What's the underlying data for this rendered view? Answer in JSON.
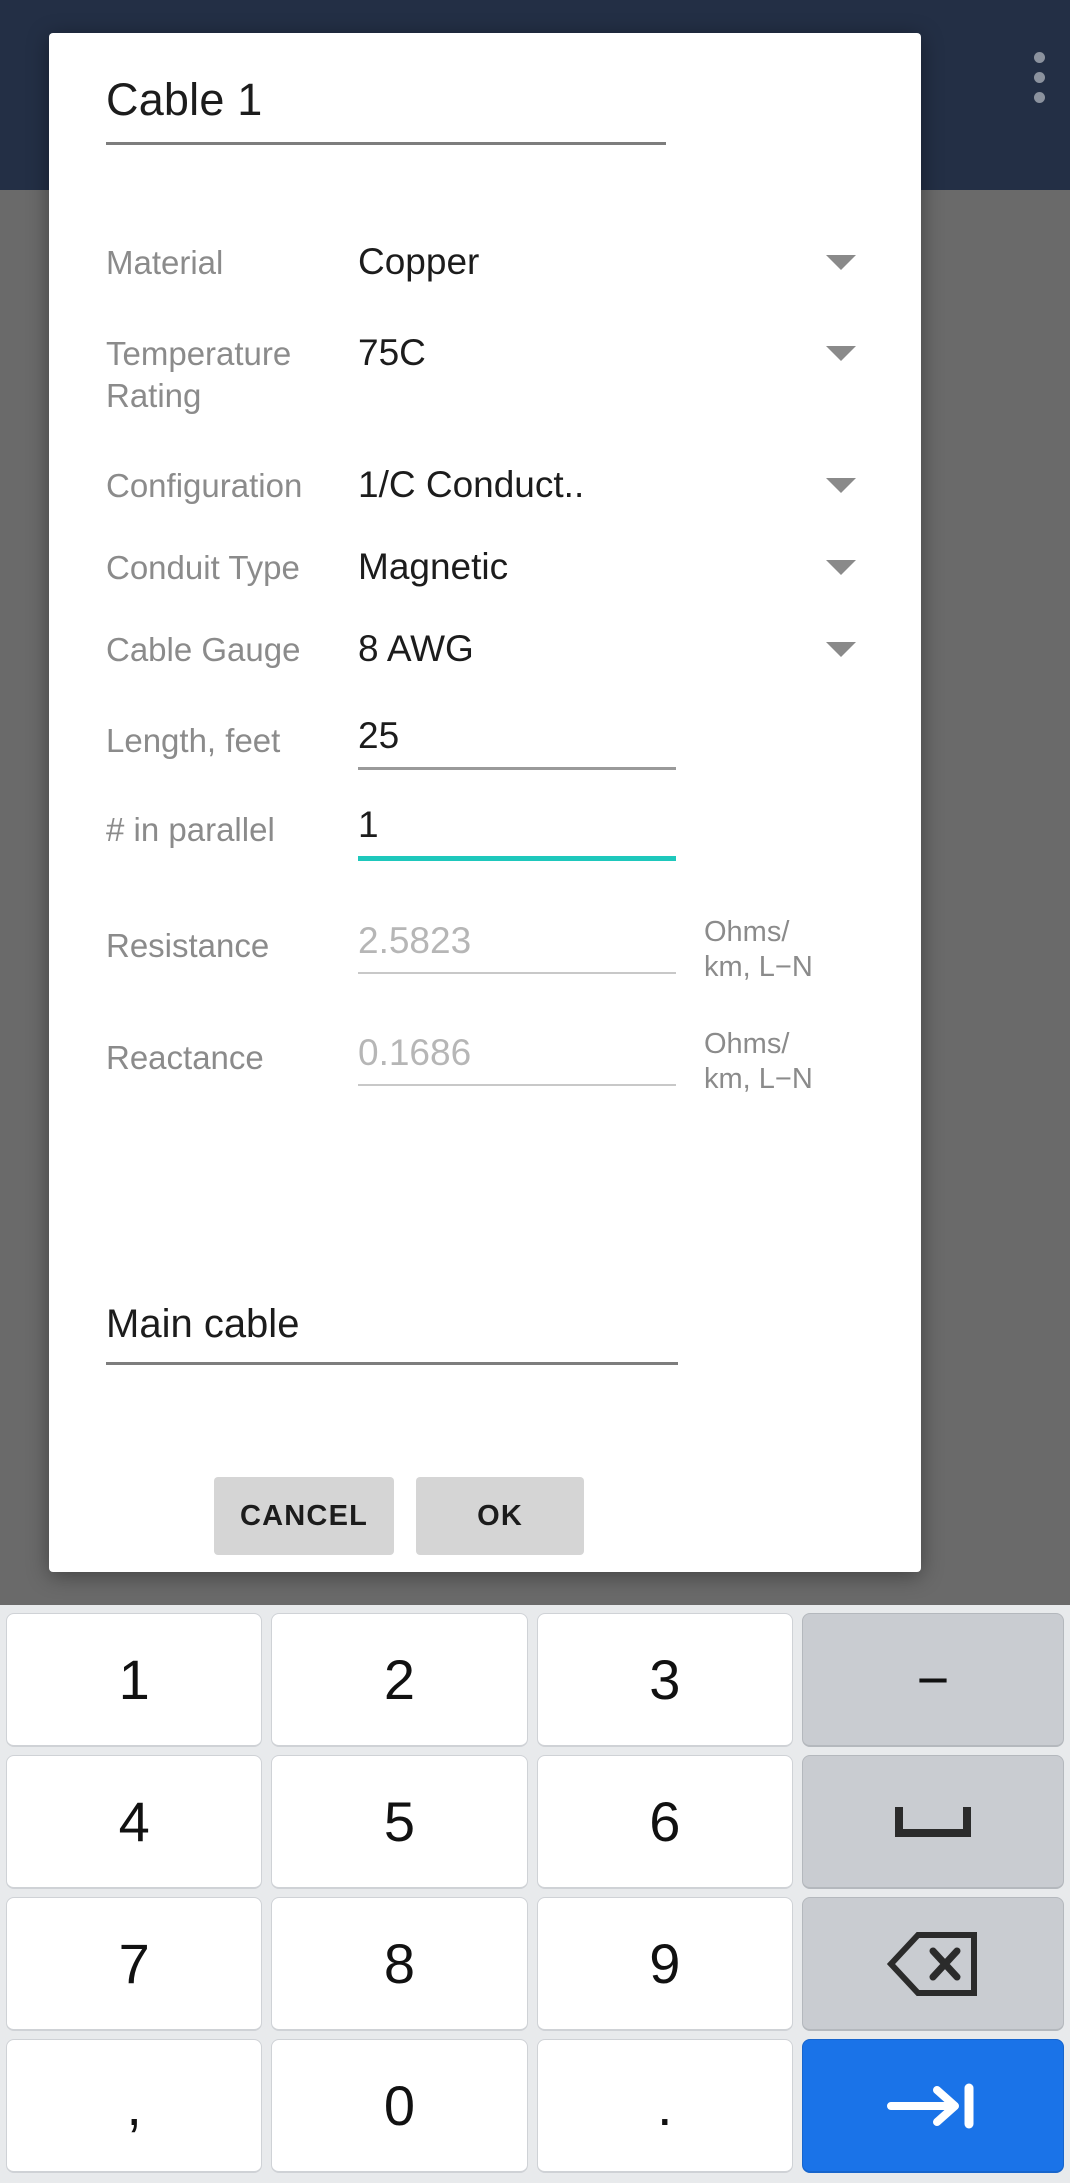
{
  "app_bar": {
    "back_icon": "back-arrow-icon",
    "overflow_icon": "more-vertical-icon"
  },
  "dialog": {
    "title": {
      "value": "Cable 1",
      "name": "cable-name-field"
    },
    "fields": [
      {
        "label": "Material",
        "value": "Copper",
        "kind": "select"
      },
      {
        "label": "Temperature Rating",
        "value": "75C",
        "kind": "select"
      },
      {
        "label": "Configuration",
        "value": "1/C Conduct..",
        "kind": "select"
      },
      {
        "label": "Conduit Type",
        "value": "Magnetic",
        "kind": "select"
      },
      {
        "label": "Cable Gauge",
        "value": "8 AWG",
        "kind": "select"
      },
      {
        "label": "Length, feet",
        "value": "25",
        "kind": "input"
      },
      {
        "label": "# in parallel",
        "value": "1",
        "kind": "input",
        "focused": true
      },
      {
        "label": "Resistance",
        "value": "2.5823",
        "kind": "input",
        "dim": true,
        "unit": "Ohms/\nkm, L−N"
      },
      {
        "label": "Reactance",
        "value": "0.1686",
        "kind": "input",
        "dim": true,
        "unit": "Ohms/\nkm, L−N"
      }
    ],
    "note": {
      "value": "Main cable"
    },
    "actions": {
      "cancel_label": "CANCEL",
      "ok_label": "OK"
    },
    "accent_color": "#1ec8bc"
  },
  "keyboard": {
    "rows": [
      [
        {
          "label": "1",
          "name": "key-1",
          "type": "digit"
        },
        {
          "label": "2",
          "name": "key-2",
          "type": "digit"
        },
        {
          "label": "3",
          "name": "key-3",
          "type": "digit"
        },
        {
          "label": "−",
          "name": "key-minus",
          "type": "func"
        }
      ],
      [
        {
          "label": "4",
          "name": "key-4",
          "type": "digit"
        },
        {
          "label": "5",
          "name": "key-5",
          "type": "digit"
        },
        {
          "label": "6",
          "name": "key-6",
          "type": "digit"
        },
        {
          "label": "",
          "name": "key-space",
          "type": "space"
        }
      ],
      [
        {
          "label": "7",
          "name": "key-7",
          "type": "digit"
        },
        {
          "label": "8",
          "name": "key-8",
          "type": "digit"
        },
        {
          "label": "9",
          "name": "key-9",
          "type": "digit"
        },
        {
          "label": "",
          "name": "key-backspace",
          "type": "backspace"
        }
      ],
      [
        {
          "label": ",",
          "name": "key-comma",
          "type": "digit"
        },
        {
          "label": "0",
          "name": "key-0",
          "type": "digit"
        },
        {
          "label": ".",
          "name": "key-period",
          "type": "digit"
        },
        {
          "label": "",
          "name": "key-next",
          "type": "next"
        }
      ]
    ],
    "accent_color": "#1a73e8"
  }
}
